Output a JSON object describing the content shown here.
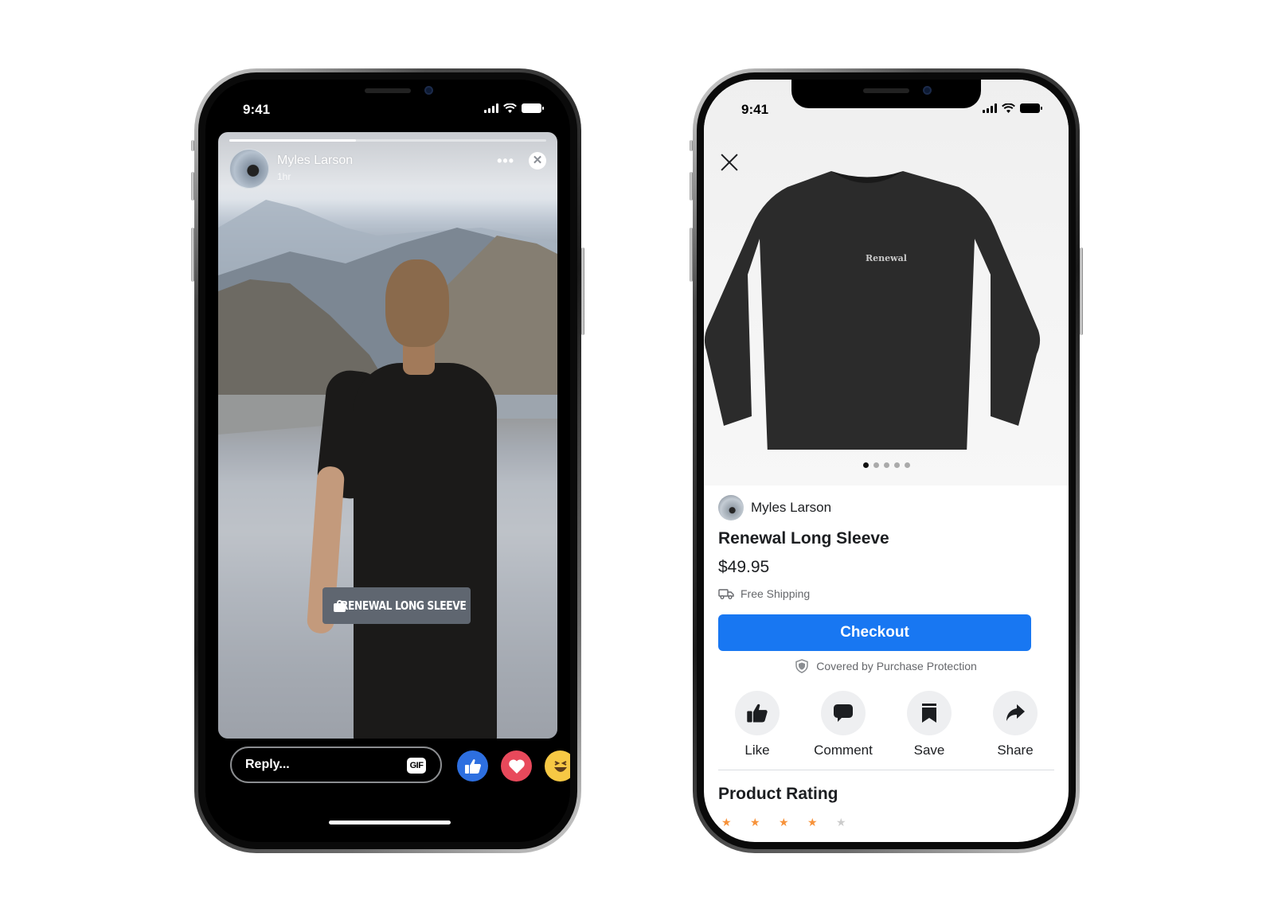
{
  "status_bar": {
    "time": "9:41"
  },
  "story": {
    "progress_fraction": 0.4,
    "author_name": "Myles Larson",
    "posted_ago": "1hr",
    "more_label": "•••",
    "close_label": "✕",
    "product_tag_label": "RENEWAL LONG SLEEVE",
    "reply_placeholder": "Reply...",
    "gif_label": "GIF",
    "reactions": [
      "like",
      "love",
      "haha"
    ]
  },
  "product": {
    "image_text": "Renewal",
    "carousel": {
      "total": 5,
      "active_index": 0
    },
    "seller_name": "Myles Larson",
    "title": "Renewal Long Sleeve",
    "price": "$49.95",
    "shipping": "Free Shipping",
    "checkout_label": "Checkout",
    "protection": "Covered by Purchase Protection",
    "actions": [
      {
        "label": "Like",
        "icon": "thumbs-up-icon"
      },
      {
        "label": "Comment",
        "icon": "comment-icon"
      },
      {
        "label": "Save",
        "icon": "bookmark-icon"
      },
      {
        "label": "Share",
        "icon": "share-icon"
      }
    ],
    "rating_section_title": "Product Rating",
    "rating": {
      "filled": 4,
      "total": 5
    }
  },
  "colors": {
    "accent_blue": "#1877f2",
    "like_blue": "#2d6fe0",
    "love_red": "#e8495b",
    "haha_yellow": "#f6c844",
    "star_orange": "#f7923a",
    "tag_gray": "#5f6670"
  }
}
